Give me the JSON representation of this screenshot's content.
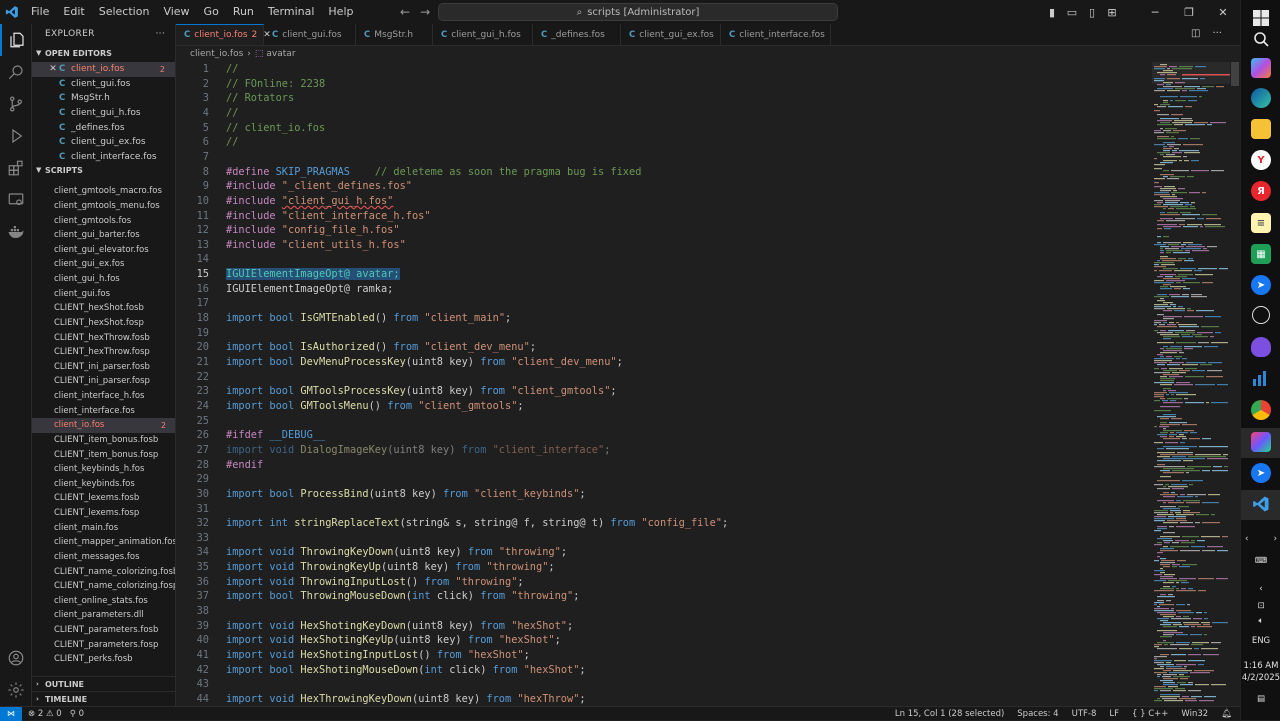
{
  "window": {
    "menu": [
      "File",
      "Edit",
      "Selection",
      "View",
      "Go",
      "Run",
      "Terminal",
      "Help"
    ],
    "command_center": "scripts [Administrator]"
  },
  "sidebar": {
    "title": "EXPLORER",
    "open_editors_label": "OPEN EDITORS",
    "open_editors": [
      {
        "name": "client_io.fos",
        "badge": "2",
        "active": true
      },
      {
        "name": "client_gui.fos"
      },
      {
        "name": "MsgStr.h"
      },
      {
        "name": "client_gui_h.fos"
      },
      {
        "name": "_defines.fos"
      },
      {
        "name": "client_gui_ex.fos"
      },
      {
        "name": "client_interface.fos"
      }
    ],
    "scripts_label": "SCRIPTS",
    "files": [
      "client_gmtools_macro.fos",
      "client_gmtools_menu.fos",
      "client_gmtools.fos",
      "client_gui_barter.fos",
      "client_gui_elevator.fos",
      "client_gui_ex.fos",
      "client_gui_h.fos",
      "client_gui.fos",
      "CLIENT_hexShot.fosb",
      "CLIENT_hexShot.fosp",
      "CLIENT_hexThrow.fosb",
      "CLIENT_hexThrow.fosp",
      "CLIENT_ini_parser.fosb",
      "CLIENT_ini_parser.fosp",
      "client_interface_h.fos",
      "client_interface.fos",
      "client_io.fos",
      "CLIENT_item_bonus.fosb",
      "CLIENT_item_bonus.fosp",
      "client_keybinds_h.fos",
      "client_keybinds.fos",
      "CLIENT_lexems.fosb",
      "CLIENT_lexems.fosp",
      "client_main.fos",
      "client_mapper_animation.fos",
      "client_messages.fos",
      "CLIENT_name_colorizing.fosb",
      "CLIENT_name_colorizing.fosp",
      "client_online_stats.fos",
      "client_parameters.dll",
      "CLIENT_parameters.fosb",
      "CLIENT_parameters.fosp",
      "CLIENT_perks.fosb"
    ],
    "selected_file": "client_io.fos",
    "selected_badge": "2",
    "outline_label": "OUTLINE",
    "timeline_label": "TIMELINE"
  },
  "tabs": [
    {
      "name": "client_io.fos",
      "badge": "2",
      "active": true
    },
    {
      "name": "client_gui.fos"
    },
    {
      "name": "MsgStr.h"
    },
    {
      "name": "client_gui_h.fos"
    },
    {
      "name": "_defines.fos"
    },
    {
      "name": "client_gui_ex.fos"
    },
    {
      "name": "client_interface.fos"
    }
  ],
  "breadcrumb": {
    "file": "client_io.fos",
    "symbol": "avatar"
  },
  "code_lines": [
    [
      [
        "cm",
        "//"
      ]
    ],
    [
      [
        "cm",
        "// FOnline: 2238"
      ]
    ],
    [
      [
        "cm",
        "// Rotators"
      ]
    ],
    [
      [
        "cm",
        "//"
      ]
    ],
    [
      [
        "cm",
        "// client_io.fos"
      ]
    ],
    [
      [
        "cm",
        "//"
      ]
    ],
    [],
    [
      [
        "pp",
        "#define "
      ],
      [
        "mac",
        "SKIP_PRAGMAS"
      ],
      [
        "id",
        "    "
      ],
      [
        "cm",
        "// deleteme as soon the pragma bug is fixed"
      ]
    ],
    [
      [
        "pp",
        "#include "
      ],
      [
        "st",
        "\"_client_defines.fos\""
      ]
    ],
    [
      [
        "pp",
        "#include "
      ],
      [
        "stw",
        "\"client_gui_h.fos\""
      ]
    ],
    [
      [
        "pp",
        "#include "
      ],
      [
        "st",
        "\"client_interface_h.fos\""
      ]
    ],
    [
      [
        "pp",
        "#include "
      ],
      [
        "st",
        "\"config_file_h.fos\""
      ]
    ],
    [
      [
        "pp",
        "#include "
      ],
      [
        "st",
        "\"client_utils_h.fos\""
      ]
    ],
    [],
    [
      [
        "hl",
        "IGUIElementImageOpt@ avatar;"
      ]
    ],
    [
      [
        "id",
        "IGUIElementImageOpt@ ramka;"
      ]
    ],
    [],
    [
      [
        "kw",
        "import "
      ],
      [
        "kw",
        "bool "
      ],
      [
        "fn",
        "IsGMTEnabled"
      ],
      [
        "id",
        "() "
      ],
      [
        "kw",
        "from "
      ],
      [
        "st",
        "\"client_main\""
      ],
      [
        "id",
        ";"
      ]
    ],
    [],
    [
      [
        "kw",
        "import "
      ],
      [
        "kw",
        "bool "
      ],
      [
        "fn",
        "IsAuthorized"
      ],
      [
        "id",
        "() "
      ],
      [
        "kw",
        "from "
      ],
      [
        "st",
        "\"client_dev_menu\""
      ],
      [
        "id",
        ";"
      ]
    ],
    [
      [
        "kw",
        "import "
      ],
      [
        "kw",
        "bool "
      ],
      [
        "fn",
        "DevMenuProcessKey"
      ],
      [
        "id",
        "(uint8 key) "
      ],
      [
        "kw",
        "from "
      ],
      [
        "st",
        "\"client_dev_menu\""
      ],
      [
        "id",
        ";"
      ]
    ],
    [],
    [
      [
        "kw",
        "import "
      ],
      [
        "kw",
        "bool "
      ],
      [
        "fn",
        "GMToolsProcessKey"
      ],
      [
        "id",
        "(uint8 key) "
      ],
      [
        "kw",
        "from "
      ],
      [
        "st",
        "\"client_gmtools\""
      ],
      [
        "id",
        ";"
      ]
    ],
    [
      [
        "kw",
        "import "
      ],
      [
        "kw",
        "bool "
      ],
      [
        "fn",
        "GMToolsMenu"
      ],
      [
        "id",
        "() "
      ],
      [
        "kw",
        "from "
      ],
      [
        "st",
        "\"client_gmtools\""
      ],
      [
        "id",
        ";"
      ]
    ],
    [],
    [
      [
        "pp",
        "#ifdef "
      ],
      [
        "mac",
        "__DEBUG__"
      ]
    ],
    [
      [
        "dkw",
        "import "
      ],
      [
        "dkw",
        "void "
      ],
      [
        "dfn",
        "DialogImageKey"
      ],
      [
        "did",
        "(uint8 key) "
      ],
      [
        "dkw",
        "from "
      ],
      [
        "dst",
        "\"client_interface\""
      ],
      [
        "did",
        ";"
      ]
    ],
    [
      [
        "pp",
        "#endif"
      ]
    ],
    [],
    [
      [
        "kw",
        "import "
      ],
      [
        "kw",
        "bool "
      ],
      [
        "fn",
        "ProcessBind"
      ],
      [
        "id",
        "(uint8 key) "
      ],
      [
        "kw",
        "from "
      ],
      [
        "st",
        "\"client_keybinds\""
      ],
      [
        "id",
        ";"
      ]
    ],
    [],
    [
      [
        "kw",
        "import "
      ],
      [
        "kw",
        "int "
      ],
      [
        "fn",
        "stringReplaceText"
      ],
      [
        "id",
        "(string& s, string@ f, string@ t) "
      ],
      [
        "kw",
        "from "
      ],
      [
        "st",
        "\"config_file\""
      ],
      [
        "id",
        ";"
      ]
    ],
    [],
    [
      [
        "kw",
        "import "
      ],
      [
        "kw",
        "void "
      ],
      [
        "fn",
        "ThrowingKeyDown"
      ],
      [
        "id",
        "(uint8 key) "
      ],
      [
        "kw",
        "from "
      ],
      [
        "st",
        "\"throwing\""
      ],
      [
        "id",
        ";"
      ]
    ],
    [
      [
        "kw",
        "import "
      ],
      [
        "kw",
        "void "
      ],
      [
        "fn",
        "ThrowingKeyUp"
      ],
      [
        "id",
        "(uint8 key) "
      ],
      [
        "kw",
        "from "
      ],
      [
        "st",
        "\"throwing\""
      ],
      [
        "id",
        ";"
      ]
    ],
    [
      [
        "kw",
        "import "
      ],
      [
        "kw",
        "void "
      ],
      [
        "fn",
        "ThrowingInputLost"
      ],
      [
        "id",
        "() "
      ],
      [
        "kw",
        "from "
      ],
      [
        "st",
        "\"throwing\""
      ],
      [
        "id",
        ";"
      ]
    ],
    [
      [
        "kw",
        "import "
      ],
      [
        "kw",
        "bool "
      ],
      [
        "fn",
        "ThrowingMouseDown"
      ],
      [
        "id",
        "("
      ],
      [
        "kw",
        "int "
      ],
      [
        "id",
        "click) "
      ],
      [
        "kw",
        "from "
      ],
      [
        "st",
        "\"throwing\""
      ],
      [
        "id",
        ";"
      ]
    ],
    [],
    [
      [
        "kw",
        "import "
      ],
      [
        "kw",
        "void "
      ],
      [
        "fn",
        "HexShotingKeyDown"
      ],
      [
        "id",
        "(uint8 key) "
      ],
      [
        "kw",
        "from "
      ],
      [
        "st",
        "\"hexShot\""
      ],
      [
        "id",
        ";"
      ]
    ],
    [
      [
        "kw",
        "import "
      ],
      [
        "kw",
        "void "
      ],
      [
        "fn",
        "HexShotingKeyUp"
      ],
      [
        "id",
        "(uint8 key) "
      ],
      [
        "kw",
        "from "
      ],
      [
        "st",
        "\"hexShot\""
      ],
      [
        "id",
        ";"
      ]
    ],
    [
      [
        "kw",
        "import "
      ],
      [
        "kw",
        "void "
      ],
      [
        "fn",
        "HexShotingInputLost"
      ],
      [
        "id",
        "() "
      ],
      [
        "kw",
        "from "
      ],
      [
        "st",
        "\"hexShot\""
      ],
      [
        "id",
        ";"
      ]
    ],
    [
      [
        "kw",
        "import "
      ],
      [
        "kw",
        "bool "
      ],
      [
        "fn",
        "HexShotingMouseDown"
      ],
      [
        "id",
        "("
      ],
      [
        "kw",
        "int "
      ],
      [
        "id",
        "click) "
      ],
      [
        "kw",
        "from "
      ],
      [
        "st",
        "\"hexShot\""
      ],
      [
        "id",
        ";"
      ]
    ],
    [],
    [
      [
        "kw",
        "import "
      ],
      [
        "kw",
        "void "
      ],
      [
        "fn",
        "HexThrowingKeyDown"
      ],
      [
        "id",
        "(uint8 key) "
      ],
      [
        "kw",
        "from "
      ],
      [
        "st",
        "\"hexThrow\""
      ],
      [
        "id",
        ";"
      ]
    ]
  ],
  "current_line": 15,
  "status": {
    "errors": "2",
    "warnings": "0",
    "ports": "0",
    "position": "Ln 15, Col 1 (28 selected)",
    "spaces": "Spaces: 4",
    "encoding": "UTF-8",
    "eol": "LF",
    "language": "{ } C++",
    "platform": "Win32"
  },
  "taskbar": {
    "lang": "ENG",
    "time": "1:16 AM",
    "date": "4/2/2025",
    "icons": [
      "windows-icon",
      "search-icon",
      "copilot-icon",
      "edge-icon",
      "file-explorer-icon",
      "yandex-icon",
      "yandex-browser-icon",
      "notepad-icon",
      "sheets-icon",
      "messenger-icon",
      "openai-icon",
      "app-purple-icon",
      "stats-icon",
      "chrome-icon",
      "jetbrains-icon",
      "messenger-2-icon",
      "vscode-icon"
    ]
  },
  "colors": {
    "accent": "#0078d4",
    "error": "#f88070",
    "background": "#1f1f1f"
  }
}
